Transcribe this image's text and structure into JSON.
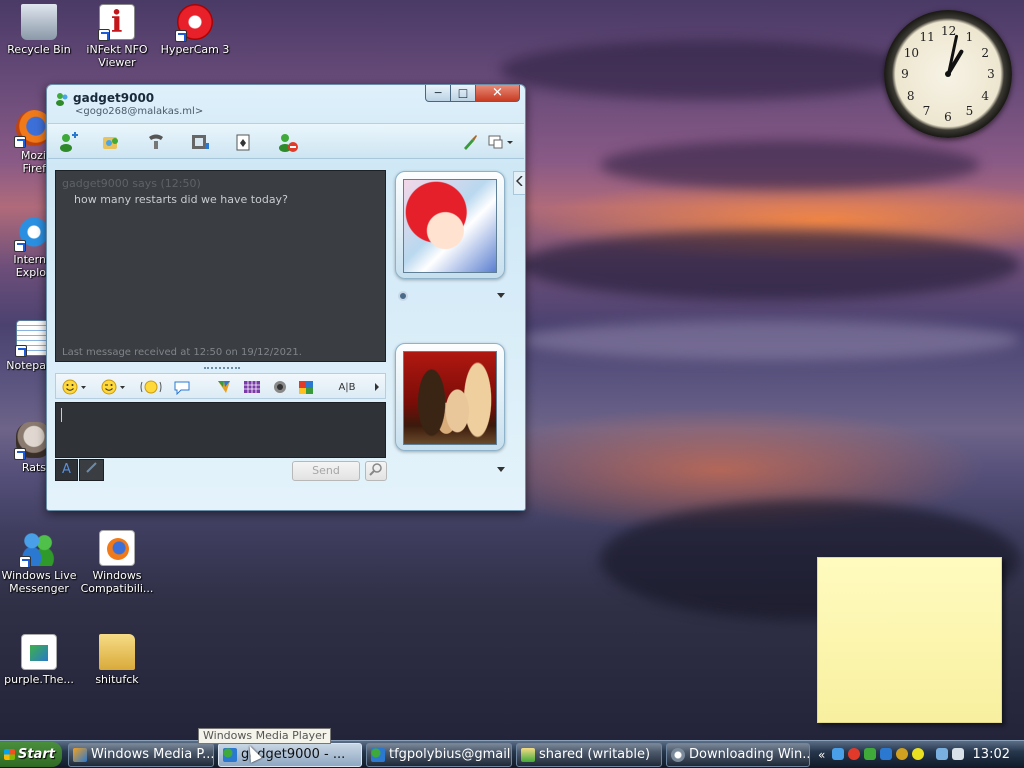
{
  "desktop": {
    "icons": [
      {
        "label": "Recycle Bin",
        "icon": "recycle-bin-icon"
      },
      {
        "label": "iNFekt NFO Viewer",
        "icon": "nfo-viewer-icon"
      },
      {
        "label": "HyperCam 3",
        "icon": "hypercam-icon"
      },
      {
        "label": "Mozi Firef",
        "icon": "firefox-icon"
      },
      {
        "label": "Intern Explo",
        "icon": "internet-explorer-icon"
      },
      {
        "label": "Notepa",
        "icon": "notepad-icon"
      },
      {
        "label": "Rats",
        "icon": "rats-icon"
      },
      {
        "label": "Windows Live Messenger",
        "icon": "messenger-icon"
      },
      {
        "label": "Windows Compatibili...",
        "icon": "firefox-doc-icon"
      },
      {
        "label": "purple.The...",
        "icon": "image-file-icon"
      },
      {
        "label": "shitufck",
        "icon": "folder-icon"
      }
    ]
  },
  "clock": {
    "numbers": [
      "12",
      "1",
      "2",
      "3",
      "4",
      "5",
      "6",
      "7",
      "8",
      "9",
      "10",
      "11"
    ],
    "time": "13:02"
  },
  "messenger": {
    "contact_name": "gadget9000",
    "contact_email": "<gogo268@malakas.ml>",
    "minimize": "─",
    "maximize": "□",
    "close": "✕",
    "history": {
      "sender_line": "gadget9000 says (12:50)",
      "message": "how many restarts did we have today?",
      "last_received": "Last message received at 12:50 on 19/12/2021."
    },
    "format_text_label": "A|B",
    "mode_a": "A",
    "send_label": "Send"
  },
  "tooltip": "Windows Media Player",
  "taskbar": {
    "start_label": "Start",
    "tasks": [
      {
        "label": "Windows Media P..."
      },
      {
        "label": "gadget9000 - ..."
      },
      {
        "label": "tfgpolybius@gmail...."
      },
      {
        "label": "shared (writable)"
      },
      {
        "label": "Downloading Win..."
      }
    ],
    "tray_chevron": "«",
    "clock": "13:02"
  },
  "colors": {
    "accent": "#1e5bd6",
    "title_close": "#c83c22",
    "chat_bg": "#3a3d41"
  }
}
